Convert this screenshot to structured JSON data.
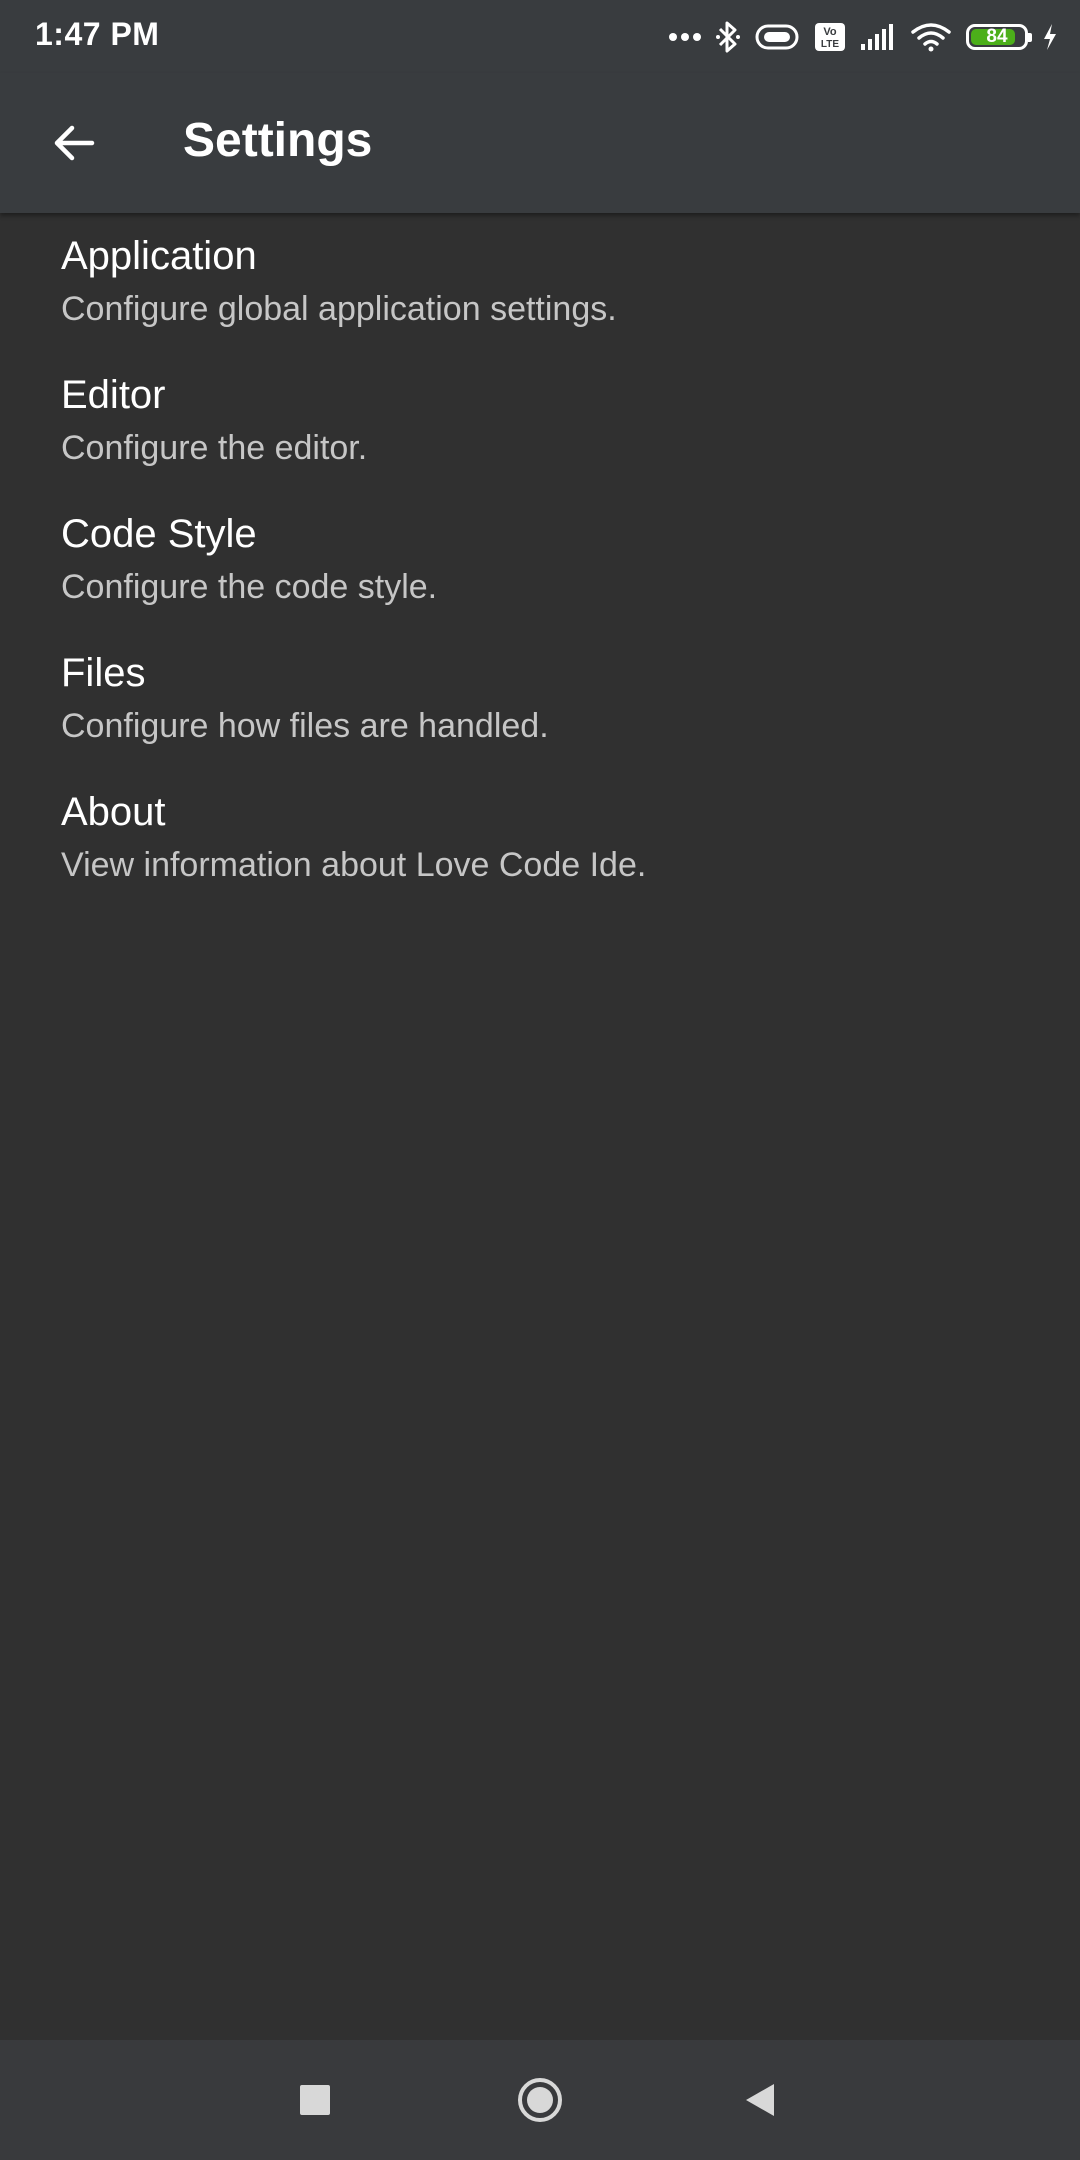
{
  "status_bar": {
    "time": "1:47 PM",
    "battery_level": "84",
    "battery_fraction": 0.84,
    "icons": [
      "more-dots-icon",
      "bluetooth-icon",
      "vibrate-icon",
      "volte-icon",
      "signal-icon",
      "wifi-icon",
      "battery-icon",
      "charging-icon"
    ],
    "volte_label": "Vo LTE"
  },
  "app_bar": {
    "title": "Settings",
    "back_icon": "arrow-left-icon"
  },
  "settings": {
    "items": [
      {
        "title": "Application",
        "summary": "Configure global application settings."
      },
      {
        "title": "Editor",
        "summary": "Configure the editor."
      },
      {
        "title": "Code Style",
        "summary": "Configure the code style."
      },
      {
        "title": "Files",
        "summary": "Configure how files are handled."
      },
      {
        "title": "About",
        "summary": "View information about Love Code Ide."
      }
    ]
  },
  "nav_bar": {
    "buttons": [
      "recents-square-icon",
      "home-circle-icon",
      "back-triangle-icon"
    ]
  },
  "colors": {
    "background": "#303030",
    "toolbar": "#393c3f",
    "nav_bar": "#393a3d",
    "title_text": "#ffffff",
    "summary_text": "#c6c6c6",
    "battery_green": "#4caf1a"
  }
}
